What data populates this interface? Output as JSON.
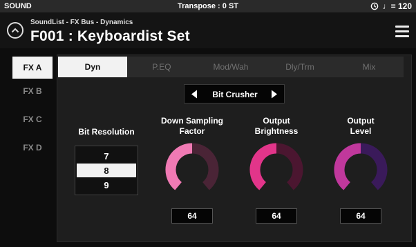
{
  "statusbar": {
    "mode": "SOUND",
    "transpose": "Transpose : 0 ST",
    "clock_icon": "clock-icon",
    "tempo": "♩= 120"
  },
  "header": {
    "breadcrumb": "SoundList - FX Bus - Dynamics",
    "title": "F001 : Keyboardist Set",
    "up_icon": "chevron-up-icon",
    "menu_icon": "hamburger-menu-icon"
  },
  "fx_tabs": [
    {
      "label": "FX A",
      "active": true
    },
    {
      "label": "FX B",
      "active": false
    },
    {
      "label": "FX C",
      "active": false
    },
    {
      "label": "FX D",
      "active": false
    }
  ],
  "section_tabs": [
    {
      "label": "Dyn",
      "active": true
    },
    {
      "label": "P.EQ",
      "active": false
    },
    {
      "label": "Mod/Wah",
      "active": false
    },
    {
      "label": "Dly/Trm",
      "active": false
    },
    {
      "label": "Mix",
      "active": false
    }
  ],
  "effect": {
    "name": "Bit Crusher",
    "prev_icon": "triangle-left-icon",
    "next_icon": "triangle-right-icon"
  },
  "bit_resolution": {
    "label": "Bit Resolution",
    "options": [
      "7",
      "8",
      "9"
    ],
    "selected": "8"
  },
  "knobs": [
    {
      "label_line1": "Down Sampling",
      "label_line2": "Factor",
      "value": "64",
      "level": 0.5,
      "color": "#f07ab4",
      "track": "#4a2436"
    },
    {
      "label_line1": "Output",
      "label_line2": "Brightness",
      "value": "64",
      "level": 0.5,
      "color": "#e2358a",
      "track": "#4b1630"
    },
    {
      "label_line1": "Output",
      "label_line2": "Level",
      "value": "64",
      "level": 0.5,
      "color": "#c0389c",
      "track": "#3a1a5a"
    }
  ]
}
